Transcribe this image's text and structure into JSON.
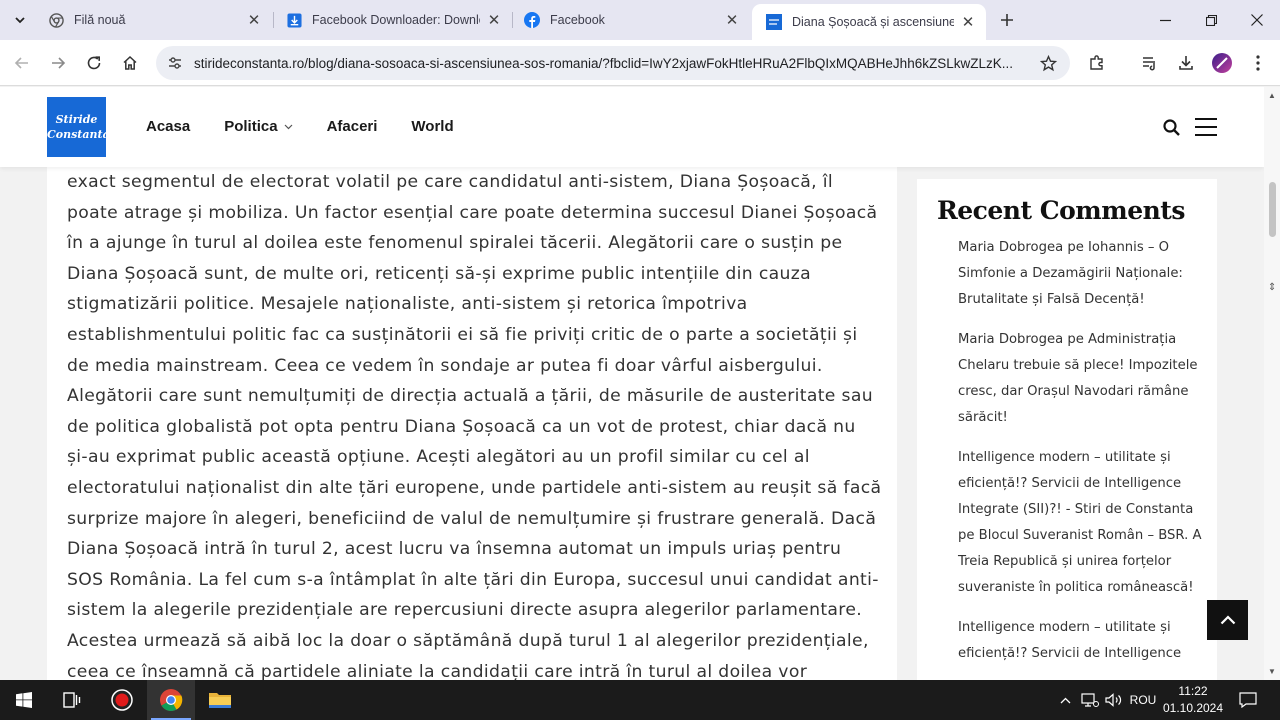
{
  "browser": {
    "tabs": [
      {
        "title": "Filă nouă",
        "active": false
      },
      {
        "title": "Facebook Downloader: Downlo",
        "active": false
      },
      {
        "title": "Facebook",
        "active": false
      },
      {
        "title": "Diana Șoșoacă și ascensiunea S",
        "active": true
      }
    ],
    "url": "stirideconstanta.ro/blog/diana-sosoaca-si-ascensiunea-sos-romania/?fbclid=IwY2xjawFokHtleHRuA2FlbQIxMQABHeJhh6kZSLkwZLzK..."
  },
  "site": {
    "logo_line1": "Stiride",
    "logo_line2": "Constanta",
    "nav": [
      {
        "label": "Acasa"
      },
      {
        "label": "Politica",
        "has_dropdown": true
      },
      {
        "label": "Afaceri"
      },
      {
        "label": "World"
      }
    ]
  },
  "article": {
    "text": "exact segmentul de electorat volatil pe care candidatul anti-sistem, Diana Șoșoacă, îl poate atrage și mobiliza. Un factor esențial care poate determina succesul Dianei Șoșoacă în a ajunge în turul al doilea este fenomenul spiralei tăcerii. Alegătorii care o susțin pe Diana Șoșoacă sunt, de multe ori, reticenți să-și exprime public intențiile din cauza stigmatizării politice. Mesajele naționaliste, anti-sistem și retorica împotriva establishmentului politic fac ca susținătorii ei să fie priviți critic de o parte a societății și de media mainstream. Ceea ce vedem în sondaje ar putea fi doar vârful aisbergului. Alegătorii care sunt nemulțumiți de direcția actuală a țării, de măsurile de austeritate sau de politica globalistă pot opta pentru Diana Șoșoacă ca un vot de protest, chiar dacă nu și-au exprimat public această opțiune. Acești alegători au un profil similar cu cel al electoratului naționalist din alte țări europene, unde partidele anti-sistem au reușit să facă surprize majore în alegeri, beneficiind de valul de nemulțumire și frustrare generală. Dacă Diana Șoșoacă intră în turul 2, acest lucru va însemna automat un impuls uriaș pentru SOS România. La fel cum s-a întâmplat în alte țări din Europa, succesul unui candidat anti-sistem la alegerile prezidențiale are repercusiuni directe asupra alegerilor parlamentare. Acestea urmează să aibă loc la doar o săptămână după turul 1 al alegerilor prezidențiale, ceea ce înseamnă că partidele aliniate la candidații care intră în turul al doilea vor beneficia masiv de această"
  },
  "sidebar": {
    "title": "Recent Comments",
    "comments": [
      "Maria Dobrogea pe Iohannis – O Simfonie a Dezamăgirii Naționale: Brutalitate și Falsă Decență!",
      "Maria Dobrogea pe Administrația Chelaru trebuie să plece! Impozitele cresc, dar Orașul Navodari rămâne sărăcit!",
      "Intelligence modern – utilitate și eficiență!? Servicii de Intelligence Integrate (SII)?! - Stiri de Constanta pe Blocul Suveranist Român – BSR. A Treia Republică și unirea forțelor suveraniste în politica românească!",
      "Intelligence modern – utilitate și eficiență!? Servicii de Intelligence"
    ]
  },
  "taskbar": {
    "language": "ROU",
    "time": "11:22",
    "date": "01.10.2024"
  },
  "colors": {
    "logo_bg": "#1769d6",
    "tabstrip_bg": "#e6e6f2",
    "taskbar_bg": "#1b1b1b",
    "page_bg": "#f2f2f2"
  }
}
